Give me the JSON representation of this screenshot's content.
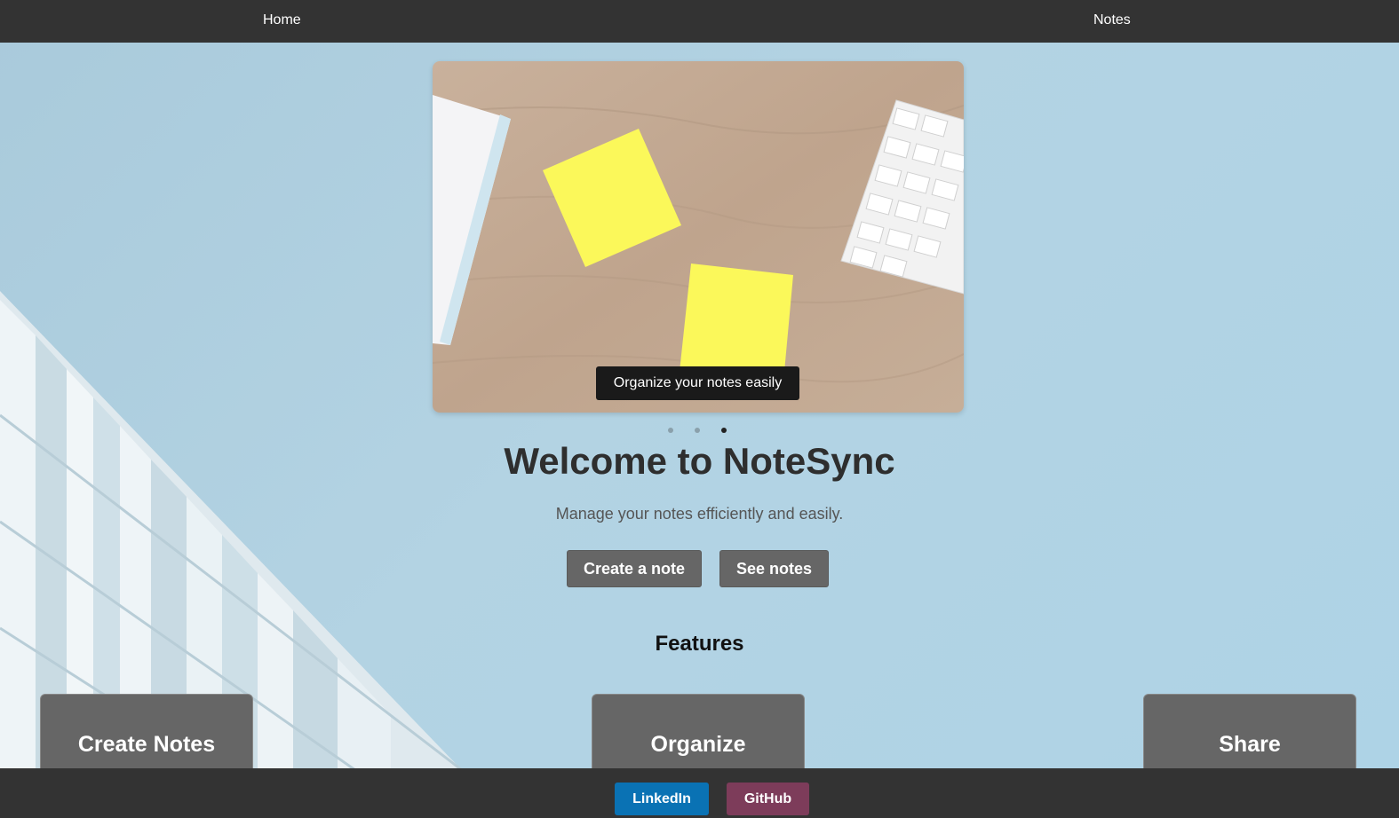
{
  "nav": {
    "home_label": "Home",
    "notes_label": "Notes"
  },
  "carousel": {
    "caption": "Organize your notes easily",
    "slide_count": 3,
    "active_slide": 3
  },
  "hero": {
    "title": "Welcome to NoteSync",
    "subtitle": "Manage your notes efficiently and easily.",
    "create_button": "Create a note",
    "see_button": "See notes"
  },
  "features": {
    "title": "Features",
    "cards": [
      {
        "label": "Create Notes"
      },
      {
        "label": "Organize"
      },
      {
        "label": "Share"
      }
    ]
  },
  "footer": {
    "linkedin_label": "LinkedIn",
    "github_label": "GitHub"
  },
  "colors": {
    "nav_bg": "#333333",
    "button_bg": "#666666",
    "linkedin": "#0a72b4",
    "github": "#7d3c5a"
  }
}
